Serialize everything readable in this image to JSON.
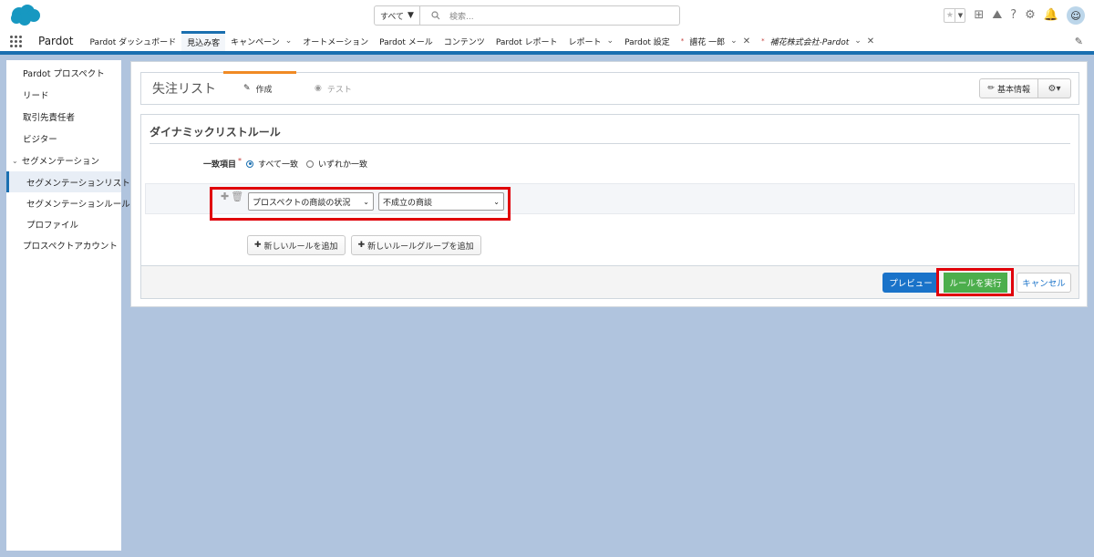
{
  "header": {
    "search_scope": "すべて",
    "search_placeholder": "検索...",
    "icons": [
      "favorites-star-icon",
      "add-icon",
      "trailhead-icon",
      "help-icon",
      "setup-gear-icon",
      "notification-bell-icon",
      "user-avatar-icon"
    ]
  },
  "nav": {
    "app_name": "Pardot",
    "items": [
      {
        "label": "Pardot ダッシュボード"
      },
      {
        "label": "見込み客"
      },
      {
        "label": "キャンペーン"
      },
      {
        "label": "オートメーション"
      },
      {
        "label": "Pardot メール"
      },
      {
        "label": "コンテンツ"
      },
      {
        "label": "Pardot レポート"
      },
      {
        "label": "レポート"
      },
      {
        "label": "Pardot 設定"
      },
      {
        "label": "譜花 一郎"
      },
      {
        "label": "補花株式会社-Pardot"
      }
    ]
  },
  "sidebar": {
    "items": [
      {
        "label": "Pardot プロスペクト"
      },
      {
        "label": "リード"
      },
      {
        "label": "取引先責任者"
      },
      {
        "label": "ビジター"
      },
      {
        "label": "セグメンテーション"
      },
      {
        "label": "セグメンテーションリスト"
      },
      {
        "label": "セグメンテーションルール"
      },
      {
        "label": "プロファイル"
      },
      {
        "label": "プロスペクトアカウント"
      }
    ]
  },
  "main": {
    "title": "失注リスト",
    "steps": [
      {
        "label": "作成"
      },
      {
        "label": "テスト"
      }
    ],
    "basic_info_label": "基本情報",
    "rules_heading": "ダイナミックリストルール",
    "match_label": "一致項目",
    "match_options": [
      {
        "label": "すべて一致"
      },
      {
        "label": "いずれか一致"
      }
    ],
    "rule": {
      "field_value": "プロスペクトの商談の状況",
      "condition_value": "不成立の商談"
    },
    "add_rule_label": "新しいルールを追加",
    "add_group_label": "新しいルールグループを追加",
    "preview_label": "プレビュー",
    "run_label": "ルールを実行",
    "cancel_label": "キャンセル"
  },
  "colors": {
    "brand_blue": "#1a6fb0",
    "run_green": "#4cae4c",
    "highlight_red": "#e0000a",
    "step_orange": "#f08a24"
  }
}
